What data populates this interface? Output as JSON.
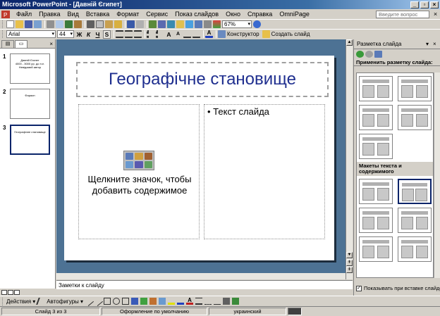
{
  "window": {
    "title": "Microsoft PowerPoint - [Давній Єгипет]",
    "min": "_",
    "restore": "▫",
    "close": "×"
  },
  "menu": {
    "items": [
      "Файл",
      "Правка",
      "Вид",
      "Вставка",
      "Формат",
      "Сервис",
      "Показ слайдов",
      "Окно",
      "Справка",
      "OmniPage"
    ],
    "help_placeholder": "Введите вопрос",
    "doc_close": "×"
  },
  "toolbar1": {
    "zoom": "67%"
  },
  "toolbar2": {
    "font": "Arial",
    "size": "44",
    "bold": "Ж",
    "italic": "К",
    "underline": "Ч",
    "shadow": "S",
    "grow_font": "A",
    "shrink_font": "A",
    "constructor": "Конструктор",
    "new_slide": "Создать слайд"
  },
  "outline": {
    "slides": [
      {
        "num": "1",
        "text": "Давній Єгипет\n4000 - 3000 рр. до н.е.\nНевідомий автор"
      },
      {
        "num": "2",
        "text": "Фараон"
      },
      {
        "num": "3",
        "text": "Географічне становище"
      }
    ]
  },
  "slide": {
    "title": "Географічне становище",
    "bullet": "• Текст слайда",
    "hint": "Щелкните значок, чтобы добавить содержимое"
  },
  "notes": {
    "placeholder": "Заметки к слайду"
  },
  "taskpane": {
    "title": "Разметка слайда",
    "close": "×",
    "apply_label": "Применить разметку слайда:",
    "section2": "Макеты текста и содержимого",
    "show_on_insert": "Показывать при вставке слайдов"
  },
  "drawing": {
    "actions": "Действия ▾",
    "autoshapes": "Автофигуры ▾"
  },
  "status": {
    "slide": "Слайд 3 из 3",
    "design": "Оформление по умолчанию",
    "language": "украинский"
  },
  "colors": {
    "title_text": "#1f2f8f",
    "slide_bg": "#4d7294",
    "titlebar": "#0a246a"
  }
}
